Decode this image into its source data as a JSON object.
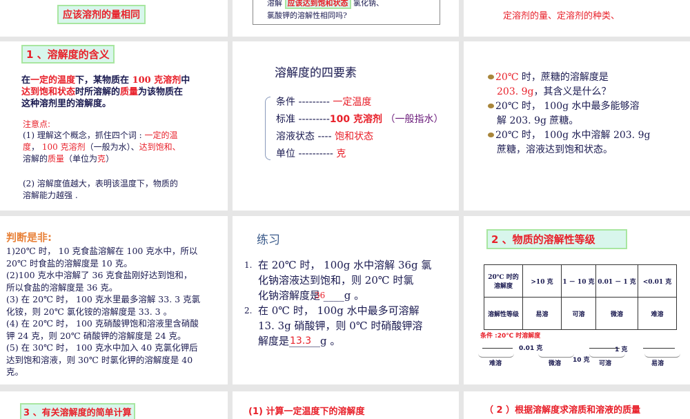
{
  "slides": {
    "s1": {
      "box": "应该溶剂的量相同"
    },
    "s2": {
      "pre": "溶解",
      "box": "应该达到饱和状态",
      "post": "氯化钠、",
      "line2": "氯酸钾的溶解性相同吗?"
    },
    "s3": {
      "text": "定溶剂的量、定溶剂的种类、"
    },
    "s4": {
      "title": "1 、溶解度的含义",
      "def": [
        "在",
        "一定的温度",
        "下，某物质在 ",
        "100 克溶剂",
        "中",
        "达到饱和状态",
        "时所溶解的",
        "质量",
        "为该物质在",
        "这种溶剂里的溶解度。"
      ],
      "note_title": "注意点:",
      "note1": [
        "(1) 理解这个概念，抓住四个词 : ",
        "一定的温",
        "度",
        "， ",
        "100 克溶剂",
        "（一般为水）、",
        "达到饱和、",
        "溶解的",
        "质量",
        "（单位为",
        "克",
        "）"
      ],
      "note2": [
        "(2) 溶解度值越大，表明该温度下，物质的",
        "溶解能力越强 ."
      ]
    },
    "s5": {
      "title": "溶解度的四要素",
      "rows": [
        {
          "label": "条件 ---------",
          "value": "一定温度"
        },
        {
          "label": "标准 ---------",
          "value": "100 克溶剂",
          "extra": "（一般指水）"
        },
        {
          "label": "溶液状态 ----",
          "value": "饱和状态"
        },
        {
          "label": "单位 ----------",
          "value": "克"
        }
      ]
    },
    "s6": {
      "b1a": "20℃",
      "b1b": " 时，蔗糖的溶解度是",
      "b1c": "203. 9g",
      "b1d": "，其含义是什么？",
      "b2a": "20℃ 时， 100g 水中最多能够溶",
      "b2b": "解 203. 9g 蔗糖。",
      "b3a": "20℃ 时， 100g 水中溶解 203. 9g",
      "b3b": "蔗糖，溶液达到饱和状态。"
    },
    "s7": {
      "title": "判断是非:",
      "lines": [
        " 1)20℃ 时， 10 克食盐溶解在 100 克水中，所以",
        "20℃ 时食盐的溶解度是 10 克。",
        "(2)100 克水中溶解了 36 克食盐刚好达到饱和，",
        "所以食盐的溶解度是 36 克。",
        "(3) 在 20℃ 时， 100 克水里最多溶解 33. 3 克氯",
        "化铵，则 20℃ 氯化铵的溶解度是 33. 3 。",
        "(4) 在 20℃ 时， 100 克硝酸钾饱和溶液里含硝酸",
        "钾 24 克，则 20℃ 硝酸钾的溶解度是 24 克。",
        "(5) 在 30℃ 时， 100 克水中加入 40 克氯化钾后",
        "达到饱和溶液，则 30℃ 时氯化钾的溶解度是 40",
        "克。"
      ]
    },
    "s8": {
      "title": "练习",
      "q1n": "1.",
      "q1": [
        "在 20℃ 时， 100g 水中溶解 36g 氯",
        "化钠溶液达到饱和，则 20℃ 时氯",
        "化钠溶解度是 ",
        "____g 。"
      ],
      "a1": "36",
      "q2n": "2.",
      "q2": [
        "在 0℃ 时， 100g 水中最多可溶解",
        "13. 3g 硝酸钾，则 0℃ 时硝酸钾溶",
        "解度是",
        "______g 。"
      ],
      "a2": "13.3"
    },
    "s9": {
      "title": "2 、物质的溶解性等级",
      "header": [
        "20℃ 时的溶解度",
        ">10 克",
        "1 － 10 克",
        "0.01 － 1 克",
        "<0.01 克"
      ],
      "row": [
        "溶解性等级",
        "易溶",
        "可溶",
        "微溶",
        "难溶"
      ],
      "cond": "条件 :20℃ 时溶解度",
      "m1": "0.01 克",
      "m2": "10 克",
      "m3": "1 克",
      "l": [
        "难溶",
        "微溶",
        "可溶",
        "易溶"
      ]
    },
    "s10": {
      "title": "3 、有关溶解度的简单计算"
    },
    "s11": {
      "title": "(1) 计算一定温度下的溶解度"
    },
    "s12": {
      "title": "（ 2 ）根据溶解度求溶质和溶液的质量"
    }
  }
}
